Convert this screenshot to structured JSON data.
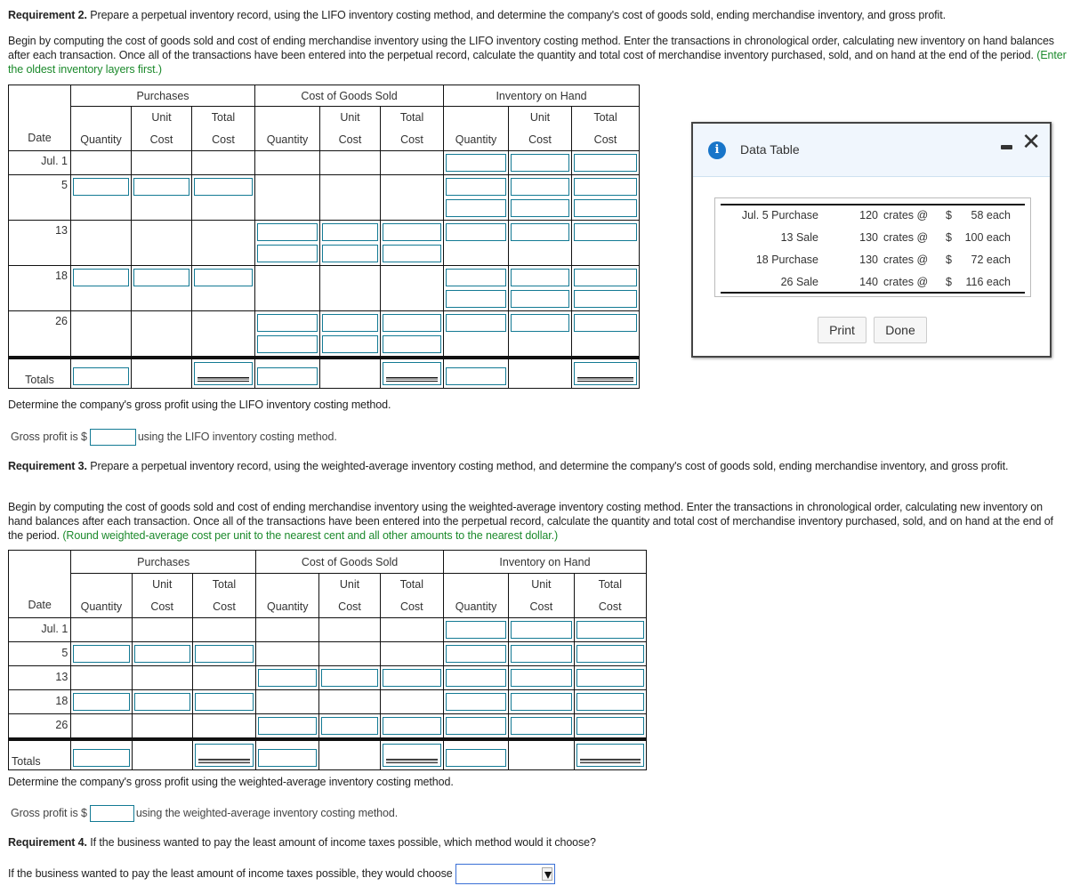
{
  "req2": {
    "heading_bold": "Requirement 2.",
    "heading_text": " Prepare a perpetual inventory record, using the LIFO inventory costing method, and determine the company's cost of goods sold, ending merchandise inventory, and gross profit.",
    "instructions": "Begin by computing the cost of goods sold and cost of ending merchandise inventory using the LIFO inventory costing method. Enter the transactions in chronological order, calculating new inventory on hand balances after each transaction. Once all of the transactions have been entered into the perpetual record, calculate the quantity and total cost of merchandise inventory purchased, sold, and on hand at the end of the period.",
    "hint": "(Enter the oldest inventory layers first.)",
    "gross_profit_prompt": "Determine the company's gross profit using the LIFO inventory costing method.",
    "gross_profit_prefix": "Gross profit is $",
    "gross_profit_suffix": "using the LIFO inventory costing method.",
    "gross_profit_value": ""
  },
  "table_headers": {
    "purchases": "Purchases",
    "cogs": "Cost of Goods Sold",
    "inventory": "Inventory on Hand",
    "date": "Date",
    "quantity": "Quantity",
    "unit": "Unit",
    "cost": "Cost",
    "total": "Total",
    "totals": "Totals"
  },
  "dates": {
    "jul1": "Jul. 1",
    "d5": "5",
    "d13": "13",
    "d18": "18",
    "d26": "26"
  },
  "req3": {
    "heading_bold": "Requirement 3.",
    "heading_text": " Prepare a perpetual inventory record, using the weighted-average inventory costing method, and determine the company's cost of goods sold, ending merchandise inventory, and gross profit.",
    "instructions": "Begin by computing the cost of goods sold and cost of ending merchandise inventory using the weighted-average inventory costing method. Enter the transactions in chronological order, calculating new inventory on hand balances after each transaction. Once all of the transactions have been entered into the perpetual record, calculate the quantity and total cost of merchandise inventory purchased, sold, and on hand at the end of the period.",
    "hint": "(Round weighted-average cost per unit to the nearest cent and all other amounts to the nearest dollar.)",
    "gross_profit_prompt": "Determine the company's gross profit using the weighted-average inventory costing method.",
    "gross_profit_prefix": "Gross profit is $",
    "gross_profit_suffix": "using the weighted-average inventory costing method.",
    "gross_profit_value": ""
  },
  "req4": {
    "heading_bold": "Requirement 4.",
    "heading_text": " If the business wanted to pay the least amount of income taxes possible, which method would it choose?",
    "prompt": "If the business wanted to pay the least amount of income taxes possible, they would choose",
    "selected_value": ""
  },
  "dialog": {
    "icon": "info-icon",
    "title": "Data Table",
    "rows": [
      {
        "desc": "Jul. 5 Purchase",
        "qty": "120",
        "unit": "crates @",
        "dollar": "$",
        "price": "58 each"
      },
      {
        "desc": "13 Sale",
        "qty": "130",
        "unit": "crates @",
        "dollar": "$",
        "price": "100 each"
      },
      {
        "desc": "18 Purchase",
        "qty": "130",
        "unit": "crates @",
        "dollar": "$",
        "price": "72 each"
      },
      {
        "desc": "26 Sale",
        "qty": "140",
        "unit": "crates @",
        "dollar": "$",
        "price": "116 each"
      }
    ],
    "print_label": "Print",
    "done_label": "Done",
    "minimize_icon": "minimize-icon",
    "close_icon": "close-icon"
  },
  "colors": {
    "input_border": "#137a94",
    "hint_green": "#1c8a2c",
    "info_blue": "#1875c9",
    "dialog_header": "#f0f6fd"
  }
}
